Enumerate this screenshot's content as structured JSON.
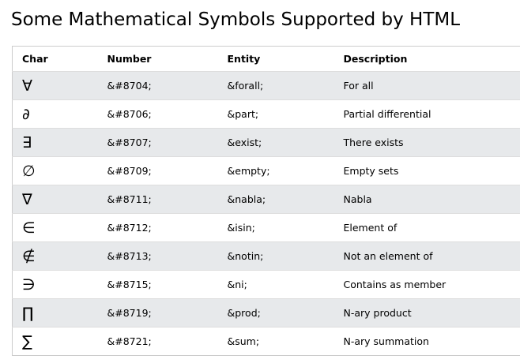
{
  "title": "Some Mathematical Symbols Supported by HTML",
  "table": {
    "headers": {
      "char": "Char",
      "number": "Number",
      "entity": "Entity",
      "description": "Description"
    },
    "rows": [
      {
        "char": "∀",
        "number": "&#8704;",
        "entity": "&forall;",
        "description": "For all"
      },
      {
        "char": "∂",
        "number": "&#8706;",
        "entity": "&part;",
        "description": "Partial differential"
      },
      {
        "char": "∃",
        "number": "&#8707;",
        "entity": "&exist;",
        "description": "There exists"
      },
      {
        "char": "∅",
        "number": "&#8709;",
        "entity": "&empty;",
        "description": "Empty sets"
      },
      {
        "char": "∇",
        "number": "&#8711;",
        "entity": "&nabla;",
        "description": "Nabla"
      },
      {
        "char": "∈",
        "number": "&#8712;",
        "entity": "&isin;",
        "description": "Element of"
      },
      {
        "char": "∉",
        "number": "&#8713;",
        "entity": "&notin;",
        "description": "Not an element of"
      },
      {
        "char": "∋",
        "number": "&#8715;",
        "entity": "&ni;",
        "description": "Contains as member"
      },
      {
        "char": "∏",
        "number": "&#8719;",
        "entity": "&prod;",
        "description": "N-ary product"
      },
      {
        "char": "∑",
        "number": "&#8721;",
        "entity": "&sum;",
        "description": "N-ary summation"
      }
    ]
  },
  "colors": {
    "stripe": "#e7e9eb",
    "border": "#cccccc",
    "text": "#000000"
  }
}
